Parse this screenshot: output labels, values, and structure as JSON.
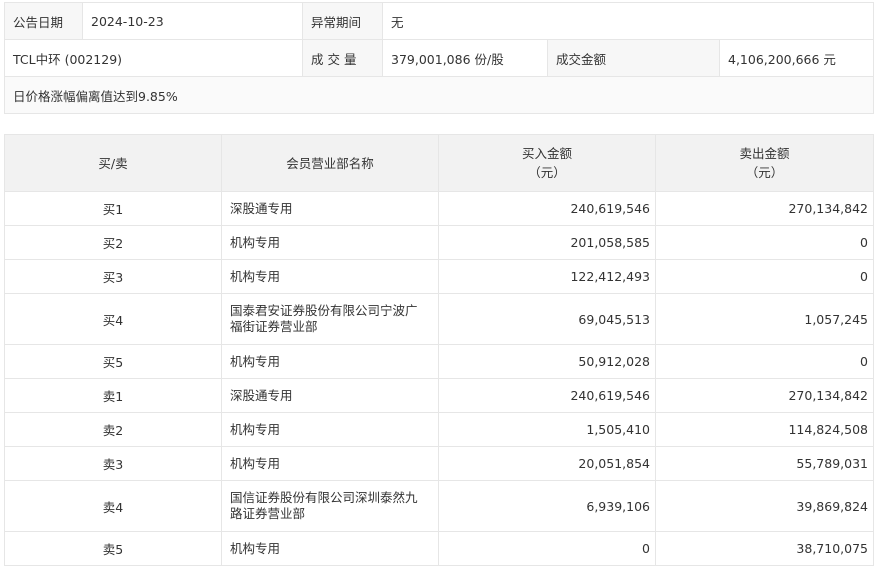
{
  "info": {
    "date_label": "公告日期",
    "date_value": "2024-10-23",
    "period_label": "异常期间",
    "period_value": "无",
    "stock_name": "TCL中环 (002129)",
    "volume_label": "成 交 量",
    "volume_value": "379,001,086 份/股",
    "amount_label": "成交金额",
    "amount_value": "4,106,200,666 元",
    "reason": "日价格涨幅偏离值达到9.85%"
  },
  "table": {
    "headers": {
      "side": "买/卖",
      "member": "会员营业部名称",
      "buy_line1": "买入金额",
      "buy_line2": "（元）",
      "sell_line1": "卖出金额",
      "sell_line2": "（元）"
    },
    "rows": [
      {
        "side": "买1",
        "member": "深股通专用",
        "buy": "240,619,546",
        "sell": "270,134,842"
      },
      {
        "side": "买2",
        "member": "机构专用",
        "buy": "201,058,585",
        "sell": "0"
      },
      {
        "side": "买3",
        "member": "机构专用",
        "buy": "122,412,493",
        "sell": "0"
      },
      {
        "side": "买4",
        "member": "国泰君安证券股份有限公司宁波广福街证券营业部",
        "buy": "69,045,513",
        "sell": "1,057,245"
      },
      {
        "side": "买5",
        "member": "机构专用",
        "buy": "50,912,028",
        "sell": "0"
      },
      {
        "side": "卖1",
        "member": "深股通专用",
        "buy": "240,619,546",
        "sell": "270,134,842"
      },
      {
        "side": "卖2",
        "member": "机构专用",
        "buy": "1,505,410",
        "sell": "114,824,508"
      },
      {
        "side": "卖3",
        "member": "机构专用",
        "buy": "20,051,854",
        "sell": "55,789,031"
      },
      {
        "side": "卖4",
        "member": "国信证券股份有限公司深圳泰然九路证券营业部",
        "buy": "6,939,106",
        "sell": "39,869,824"
      },
      {
        "side": "卖5",
        "member": "机构专用",
        "buy": "0",
        "sell": "38,710,075"
      }
    ]
  }
}
